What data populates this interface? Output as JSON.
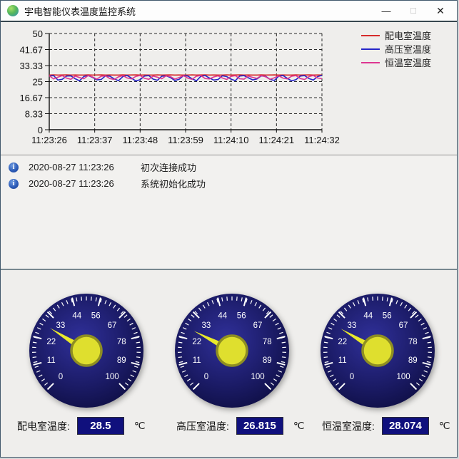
{
  "window": {
    "title": "宇电智能仪表温度监控系统",
    "controls": {
      "minimize": "—",
      "maximize": "☐",
      "close": "✕"
    }
  },
  "chart_data": {
    "type": "line",
    "title": "",
    "xlabel": "",
    "ylabel": "",
    "ylim": [
      0,
      50
    ],
    "grid": "dashed",
    "legend_position": "right",
    "x_ticks": [
      "11:23:26",
      "11:23:37",
      "11:23:48",
      "11:23:59",
      "11:24:10",
      "11:24:21",
      "11:24:32"
    ],
    "y_tick_values": [
      50,
      41.67,
      33.33,
      25,
      16.67,
      8.33,
      0
    ],
    "y_tick_labels": [
      "50",
      "41.67",
      "33.33",
      "25",
      "16.67",
      "8.33",
      "0"
    ],
    "series": [
      {
        "name": "配电室温度",
        "color": "#d62b2b",
        "values": [
          28.4,
          28.5,
          28.4,
          28.45,
          28.5,
          28.4,
          28.45,
          28.4,
          28.4,
          28.5,
          28.4,
          28.45,
          28.5,
          28.4,
          28.45,
          28.4,
          28.4,
          28.5,
          28.4,
          28.45,
          28.5,
          28.4,
          28.45,
          28.4,
          28.4,
          28.5,
          28.4,
          28.45,
          28.5,
          28.4,
          28.45,
          28.4,
          28.4,
          28.5,
          28.4,
          28.45,
          28.5,
          28.4,
          28.45,
          28.4,
          28.4,
          28.5,
          28.4,
          28.45,
          28.5,
          28.4,
          28.45,
          28.4,
          28.4,
          28.5,
          28.4,
          28.45,
          28.5,
          28.4,
          28.45,
          28.4,
          28.4,
          28.5,
          28.4,
          28.45,
          28.5,
          28.4,
          28.45,
          28.4
        ]
      },
      {
        "name": "高压室温度",
        "color": "#2626c9",
        "values": [
          27.9,
          28.1,
          25.8,
          26.2,
          27.9,
          28.0,
          26.5,
          25.4,
          27.7,
          28.1,
          27.2,
          25.9,
          26.1,
          28.0,
          27.8,
          26.4,
          25.5,
          27.6,
          28.2,
          26.8,
          25.3,
          26.0,
          27.9,
          28.1,
          26.3,
          25.7,
          27.8,
          28.0,
          27.1,
          25.6,
          26.2,
          28.1,
          27.9,
          26.5,
          25.4,
          27.7,
          28.2,
          26.9,
          25.8,
          26.1,
          28.0,
          27.6,
          26.3,
          25.5,
          27.9,
          28.1,
          27.0,
          25.9,
          26.4,
          28.0,
          27.7,
          26.2,
          25.6,
          27.8,
          28.2,
          26.7,
          25.4,
          26.0,
          27.9,
          28.1,
          26.6,
          25.8,
          27.6,
          28.3
        ]
      },
      {
        "name": "恒温室温度",
        "color": "#dd3691",
        "values": [
          28.0,
          26.4,
          27.3,
          28.1,
          26.8,
          26.2,
          27.9,
          27.1,
          26.5,
          28.2,
          27.4,
          26.3,
          27.8,
          28.0,
          26.6,
          26.1,
          27.5,
          28.1,
          26.9,
          26.4,
          27.7,
          28.2,
          26.7,
          26.2,
          27.9,
          27.3,
          26.5,
          28.0,
          27.6,
          26.3,
          27.1,
          28.1,
          26.8,
          26.2,
          27.8,
          28.2,
          26.6,
          26.4,
          27.4,
          28.0,
          26.9,
          26.1,
          27.7,
          28.1,
          26.5,
          26.3,
          27.9,
          27.2,
          26.7,
          28.2,
          27.5,
          26.2,
          27.0,
          28.0,
          26.8,
          26.4,
          27.8,
          28.1,
          26.6,
          26.1,
          27.6,
          28.2,
          26.9,
          26.5
        ]
      }
    ]
  },
  "log": {
    "entries": [
      {
        "timestamp": "2020-08-27 11:23:26",
        "message": "初次连接成功"
      },
      {
        "timestamp": "2020-08-27 11:23:26",
        "message": "系统初始化成功"
      }
    ],
    "icon": "info-icon",
    "icon_glyph": "i"
  },
  "gauge_scale": {
    "min": 0,
    "max": 100,
    "tick_labels": [
      "0",
      "11",
      "22",
      "33",
      "44",
      "56",
      "67",
      "78",
      "89",
      "100"
    ],
    "dial_color": "#14145a",
    "needle_color": "#e9e92b",
    "tick_color": "#ffffff"
  },
  "gauges": [
    {
      "label": "配电室温度:",
      "value": 28.5,
      "display": "28.5",
      "unit": "℃"
    },
    {
      "label": "高压室温度:",
      "value": 26.815,
      "display": "26.815",
      "unit": "℃"
    },
    {
      "label": "恒温室温度:",
      "value": 28.074,
      "display": "28.074",
      "unit": "℃"
    }
  ]
}
